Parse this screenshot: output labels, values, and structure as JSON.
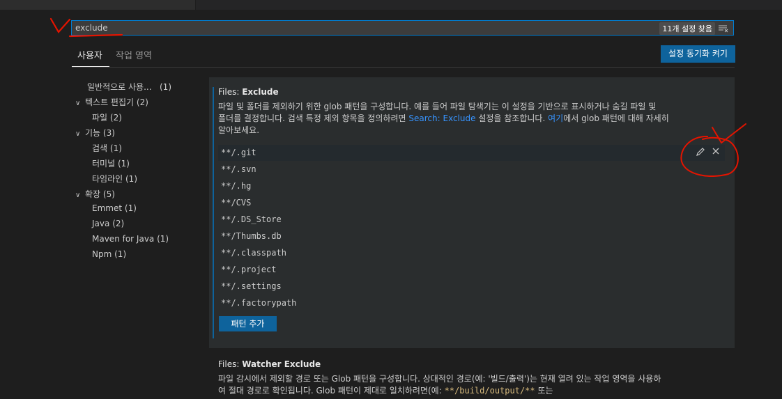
{
  "search": {
    "value": "exclude",
    "result_count": "11개 설정 찾음",
    "filter_icon": "clear-filter-icon"
  },
  "scopes": {
    "user": "사용자",
    "workspace": "작업 영역"
  },
  "sync_button": "설정 동기화 켜기",
  "toc": [
    {
      "label": "일반적으로 사용...",
      "count": "(1)"
    },
    {
      "label": "텍스트 편집기",
      "count": "(2)"
    },
    {
      "label": "파일",
      "count": "(2)"
    },
    {
      "label": "기능",
      "count": "(3)"
    },
    {
      "label": "검색",
      "count": "(1)"
    },
    {
      "label": "터미널",
      "count": "(1)"
    },
    {
      "label": "타임라인",
      "count": "(1)"
    },
    {
      "label": "확장",
      "count": "(5)"
    },
    {
      "label": "Emmet",
      "count": "(1)"
    },
    {
      "label": "Java",
      "count": "(2)"
    },
    {
      "label": "Maven for Java",
      "count": "(1)"
    },
    {
      "label": "Npm",
      "count": "(1)"
    }
  ],
  "files_exclude": {
    "category": "Files: ",
    "key": "Exclude",
    "desc_line1": "파일 및 폴더를 제외하기 위한 glob 패턴을 구성합니다. 예를 들어 파일 탐색기는 이 설정을 기반으로 표시하거나 숨길 파일 및",
    "desc_line2_a": "폴더를 결정합니다. 검색 특정 제외 항목을 정의하려면 ",
    "desc_line2_link": "Search: Exclude",
    "desc_line2_b": " 설정을 참조합니다. ",
    "desc_line2_link2": "여기",
    "desc_line2_c": "에서 glob 패턴에 대해 자세히",
    "desc_line3": "알아보세요.",
    "patterns": [
      "**/.git",
      "**/.svn",
      "**/.hg",
      "**/CVS",
      "**/.DS_Store",
      "**/Thumbs.db",
      "**/.classpath",
      "**/.project",
      "**/.settings",
      "**/.factorypath"
    ],
    "add_button": "패턴 추가"
  },
  "watcher_exclude": {
    "category": "Files: ",
    "key": "Watcher Exclude",
    "desc_line1": "파일 감시에서 제외할 경로 또는 Glob 패턴을 구성합니다. 상대적인 경로(예: '빌드/출력')는 현재 열려 있는 작업 영역을 사용하",
    "desc_line2_a": "여 절대 경로로 확인됩니다. Glob 패턴이 제대로 일치하려면(예: ",
    "desc_line2_code": "**/build/output/**",
    "desc_line2_b": " 또는"
  },
  "colors": {
    "accent": "#0e639c",
    "link": "#3794ff",
    "annotation": "#e51400"
  }
}
